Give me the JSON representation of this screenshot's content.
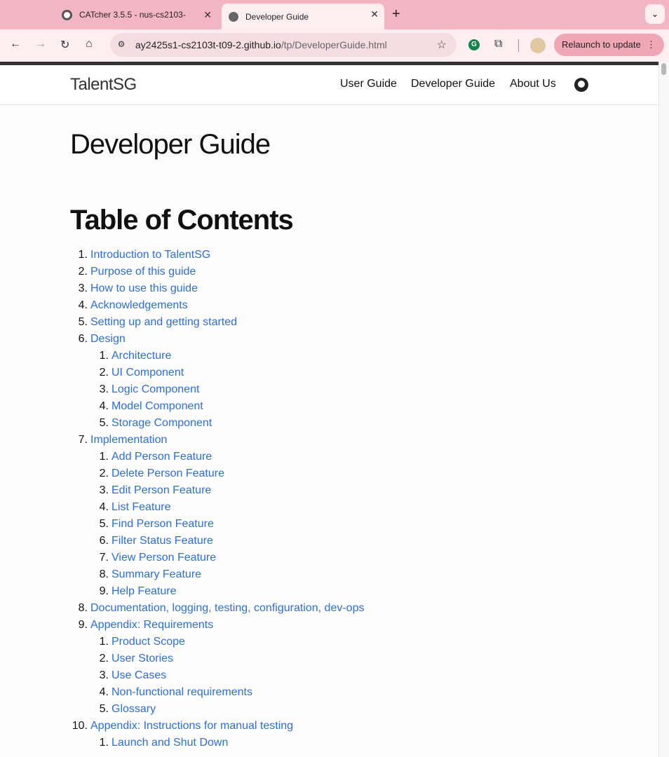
{
  "browser": {
    "tabs": [
      {
        "title": "CATcher 3.5.5 - nus-cs2103-",
        "close": "✕"
      },
      {
        "title": "Developer Guide",
        "close": "✕"
      }
    ],
    "new_tab": "+",
    "tab_menu": "⌄",
    "nav": {
      "back": "←",
      "forward": "→",
      "reload": "↻",
      "home": "⌂"
    },
    "url_host": "ay2425s1-cs2103t-t09-2.github.io",
    "url_path": "/tp/DeveloperGuide.html",
    "star": "☆",
    "relaunch_label": "Relaunch to update",
    "menu_dots": "⋮"
  },
  "site": {
    "brand": "TalentSG",
    "nav": [
      "User Guide",
      "Developer Guide",
      "About Us"
    ]
  },
  "page": {
    "title": "Developer Guide",
    "toc_heading": "Table of Contents"
  },
  "toc": [
    {
      "n": "1.",
      "text": "Introduction to TalentSG",
      "level": 1
    },
    {
      "n": "2.",
      "text": "Purpose of this guide",
      "level": 1
    },
    {
      "n": "3.",
      "text": "How to use this guide",
      "level": 1
    },
    {
      "n": "4.",
      "text": "Acknowledgements",
      "level": 1
    },
    {
      "n": "5.",
      "text": "Setting up and getting started",
      "level": 1
    },
    {
      "n": "6.",
      "text": "Design",
      "level": 1
    },
    {
      "n": "1.",
      "text": "Architecture",
      "level": 2
    },
    {
      "n": "2.",
      "text": "UI Component",
      "level": 2
    },
    {
      "n": "3.",
      "text": "Logic Component",
      "level": 2
    },
    {
      "n": "4.",
      "text": "Model Component",
      "level": 2
    },
    {
      "n": "5.",
      "text": "Storage Component",
      "level": 2
    },
    {
      "n": "7.",
      "text": "Implementation",
      "level": 1
    },
    {
      "n": "1.",
      "text": "Add Person Feature",
      "level": 2
    },
    {
      "n": "2.",
      "text": "Delete Person Feature",
      "level": 2
    },
    {
      "n": "3.",
      "text": "Edit Person Feature",
      "level": 2
    },
    {
      "n": "4.",
      "text": "List Feature",
      "level": 2
    },
    {
      "n": "5.",
      "text": "Find Person Feature",
      "level": 2
    },
    {
      "n": "6.",
      "text": "Filter Status Feature",
      "level": 2
    },
    {
      "n": "7.",
      "text": "View Person Feature",
      "level": 2
    },
    {
      "n": "8.",
      "text": "Summary Feature",
      "level": 2
    },
    {
      "n": "9.",
      "text": "Help Feature",
      "level": 2
    },
    {
      "n": "8.",
      "text": "Documentation, logging, testing, configuration, dev-ops",
      "level": 1
    },
    {
      "n": "9.",
      "text": "Appendix: Requirements",
      "level": 1
    },
    {
      "n": "1.",
      "text": "Product Scope",
      "level": 2
    },
    {
      "n": "2.",
      "text": "User Stories",
      "level": 2
    },
    {
      "n": "3.",
      "text": "Use Cases",
      "level": 2
    },
    {
      "n": "4.",
      "text": "Non-functional requirements",
      "level": 2
    },
    {
      "n": "5.",
      "text": "Glossary",
      "level": 2
    },
    {
      "n": "10.",
      "text": "Appendix: Instructions for manual testing",
      "level": 1
    },
    {
      "n": "1.",
      "text": "Launch and Shut Down",
      "level": 2
    }
  ]
}
